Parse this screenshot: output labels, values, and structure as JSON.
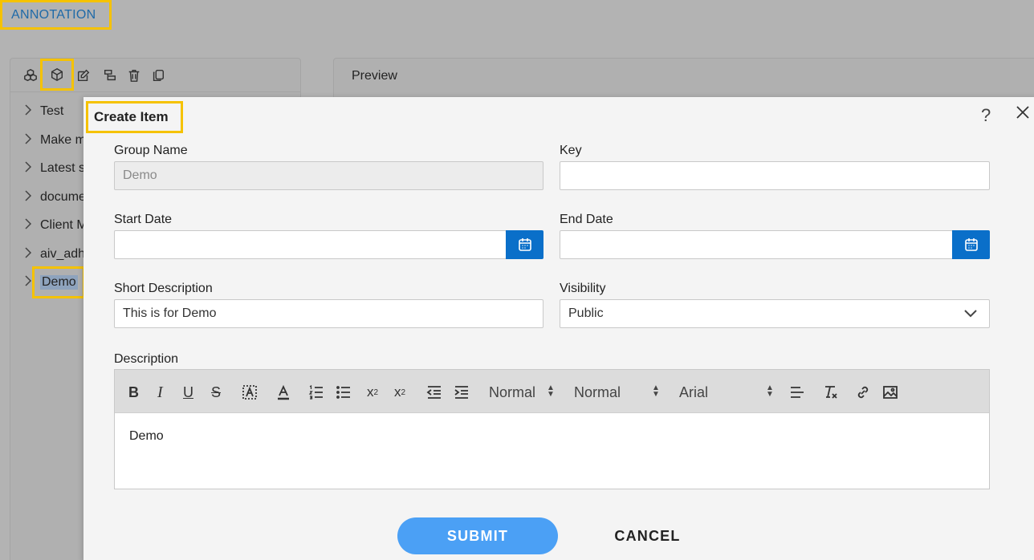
{
  "page": {
    "title": "ANNOTATION"
  },
  "left_panel": {
    "toolbar_icons": [
      "group-icon",
      "cube-icon",
      "edit-icon",
      "copy-tree-icon",
      "trash-icon",
      "duplicate-icon"
    ],
    "tree_items": [
      "Test",
      "Make m",
      "Latest s",
      "docume",
      "Client M",
      "aiv_adh",
      "Demo"
    ]
  },
  "right_panel": {
    "title": "Preview"
  },
  "modal": {
    "title": "Create Item",
    "help": "?",
    "group_name": {
      "label": "Group Name",
      "value": "Demo"
    },
    "key": {
      "label": "Key",
      "value": ""
    },
    "start_date": {
      "label": "Start Date",
      "value": ""
    },
    "end_date": {
      "label": "End Date",
      "value": ""
    },
    "short_description": {
      "label": "Short Description",
      "value": "This is for Demo"
    },
    "visibility": {
      "label": "Visibility",
      "value": "Public"
    },
    "description": {
      "label": "Description",
      "heading_select": "Normal",
      "size_select": "Normal",
      "font_select": "Arial",
      "content": "Demo"
    },
    "submit_label": "SUBMIT",
    "cancel_label": "CANCEL"
  },
  "colors": {
    "highlight": "#f5c200",
    "primary": "#0a6fc9",
    "submit": "#4ba0f5",
    "title_link": "#1f6aa8"
  }
}
